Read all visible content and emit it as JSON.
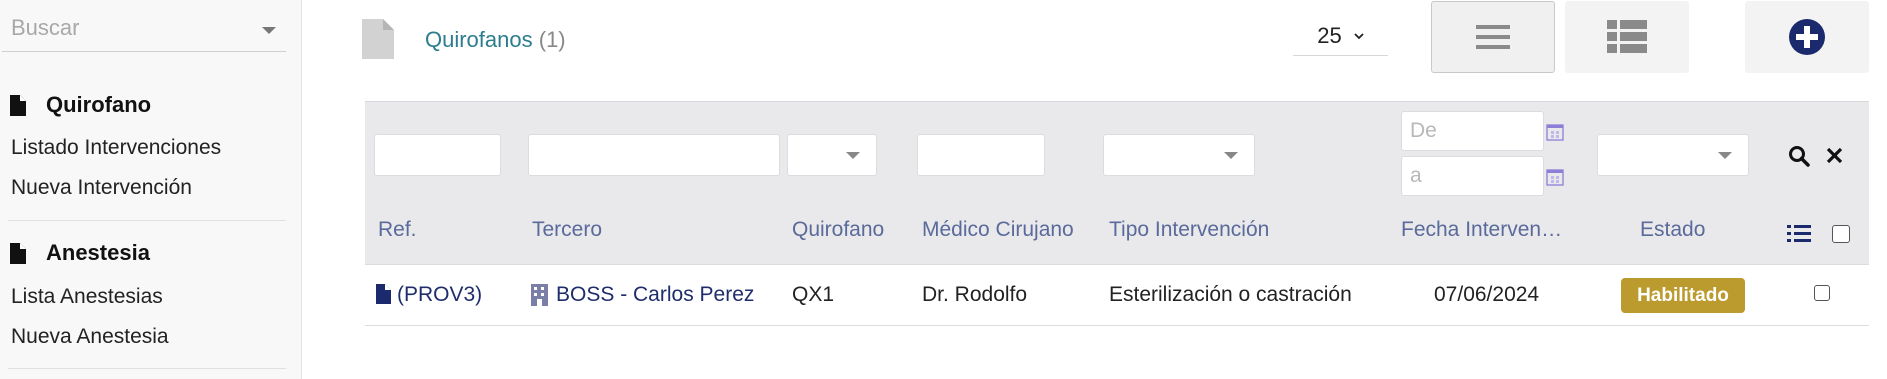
{
  "sidebar": {
    "search": {
      "placeholder": "Buscar"
    },
    "sections": [
      {
        "title": "Quirofano",
        "links": [
          "Listado Intervenciones",
          "Nueva Intervención"
        ]
      },
      {
        "title": "Anestesia",
        "links": [
          "Lista Anestesias",
          "Nueva Anestesia"
        ]
      }
    ]
  },
  "header": {
    "title": "Quirofanos",
    "count": "(1)",
    "per_page": "25",
    "icons": {
      "page": "document-icon",
      "list_view": "list-view-icon",
      "kanban_view": "kanban-view-icon",
      "add": "plus-circle-icon"
    }
  },
  "filters": {
    "date_from_placeholder": "De",
    "date_to_placeholder": "a"
  },
  "table": {
    "columns": [
      "Ref.",
      "Tercero",
      "Quirofano",
      "Médico Cirujano",
      "Tipo Intervención",
      "Fecha Interven…",
      "Estado"
    ],
    "rows": [
      {
        "ref": "(PROV3)",
        "tercero": "BOSS - Carlos Perez",
        "quirofano": "QX1",
        "medico": "Dr. Rodolfo",
        "tipo": "Esterilización o castración",
        "fecha": "07/06/2024",
        "estado": "Habilitado"
      }
    ]
  },
  "colors": {
    "title": "#2c7d8e",
    "column_header": "#5a6a9a",
    "link": "#1f2d6b",
    "badge": "#bb9a2e",
    "add_button": "#1a2a6c"
  }
}
